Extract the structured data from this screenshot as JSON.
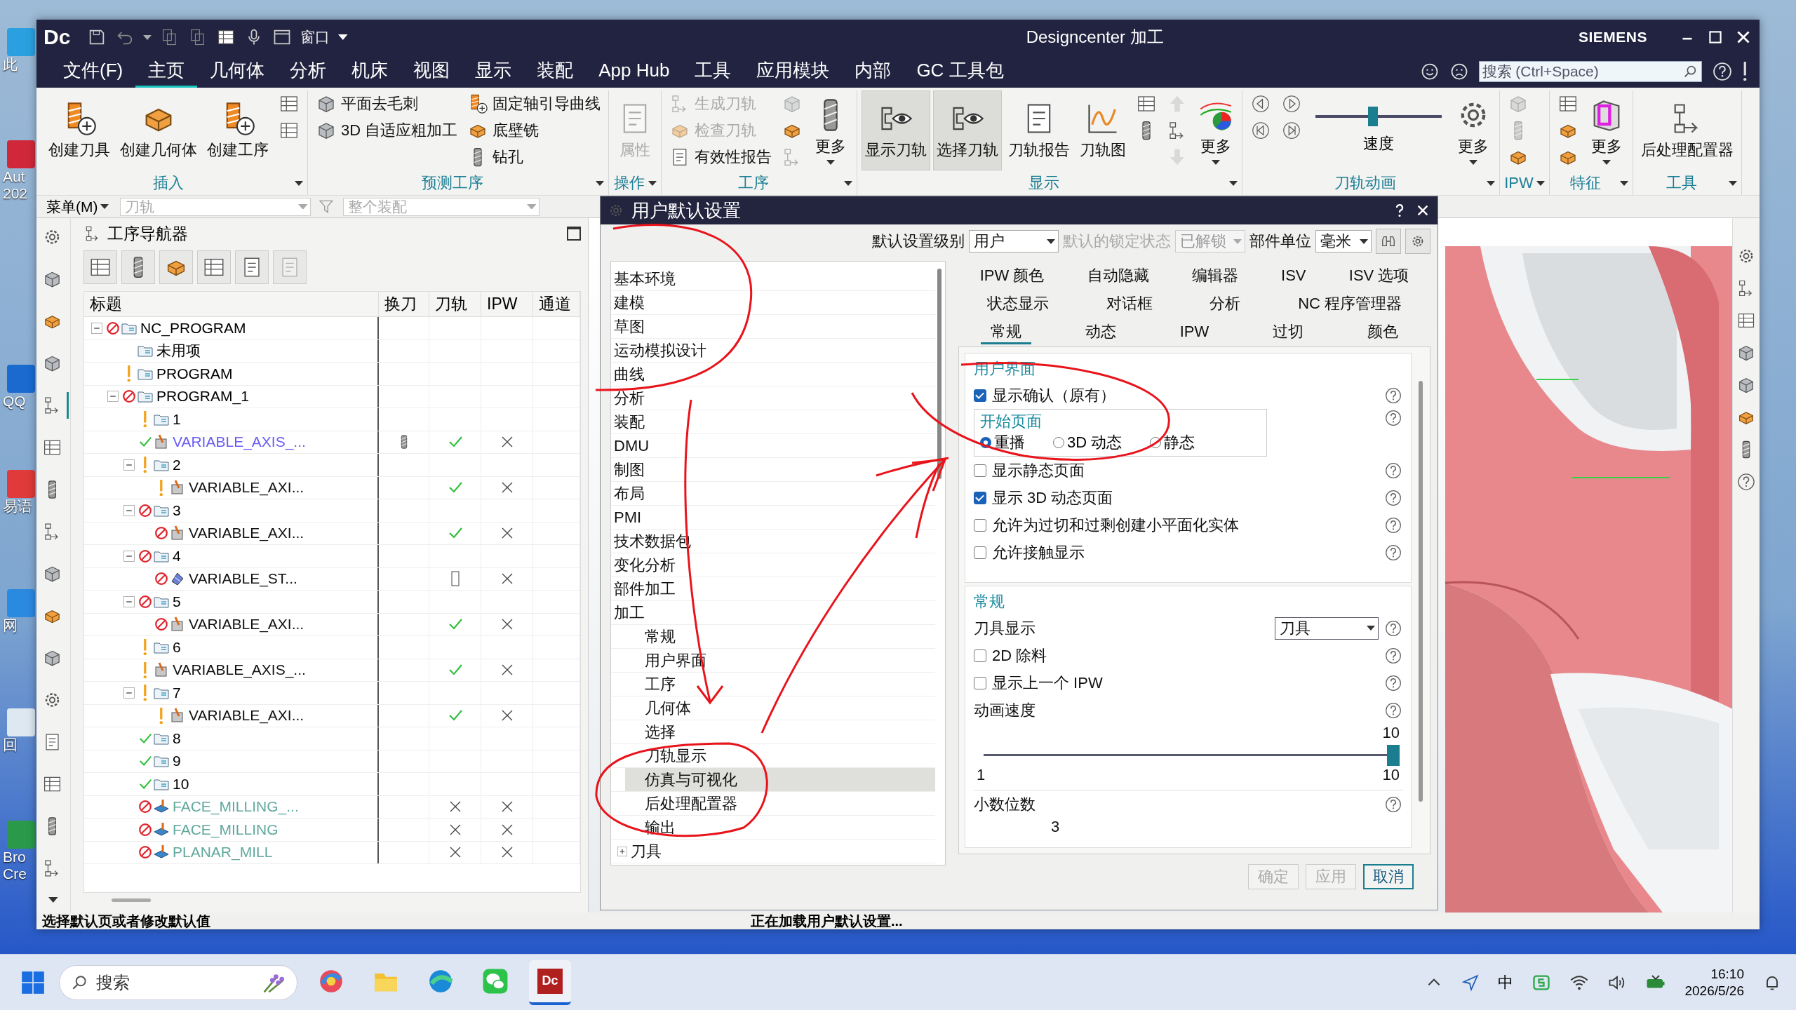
{
  "desktop": {
    "icons": [
      {
        "label": "此"
      },
      {
        "label": "Aut 202"
      },
      {
        "label": "QQ"
      },
      {
        "label": "易语"
      },
      {
        "label": "网"
      },
      {
        "label": "回"
      },
      {
        "label": "Bro Cre"
      }
    ]
  },
  "window": {
    "logo": "Dc",
    "window_menu": "窗口",
    "title": "Designcenter 加工",
    "brand": "SIEMENS"
  },
  "menu_bar": {
    "tabs": [
      {
        "label": "文件(F)",
        "selected": false
      },
      {
        "label": "主页",
        "selected": true
      },
      {
        "label": "几何体",
        "selected": false
      },
      {
        "label": "分析",
        "selected": false
      },
      {
        "label": "机床",
        "selected": false
      },
      {
        "label": "视图",
        "selected": false
      },
      {
        "label": "显示",
        "selected": false
      },
      {
        "label": "装配",
        "selected": false
      },
      {
        "label": "App Hub",
        "selected": false
      },
      {
        "label": "工具",
        "selected": false
      },
      {
        "label": "应用模块",
        "selected": false
      },
      {
        "label": "内部",
        "selected": false
      },
      {
        "label": "GC 工具包",
        "selected": false
      }
    ],
    "search": {
      "placeholder": "搜索 (Ctrl+Space)"
    }
  },
  "ribbon": {
    "groups": [
      {
        "label": "插入",
        "items": [
          {
            "kind": "large",
            "label": "创建刀具",
            "disabled": false,
            "pressed": false
          },
          {
            "kind": "large",
            "label": "创建几何体",
            "disabled": false,
            "pressed": false
          },
          {
            "kind": "large",
            "label": "创建工序",
            "disabled": false,
            "pressed": false
          },
          {
            "kind": "icon",
            "disabled": false,
            "pressed": false
          },
          {
            "kind": "icon",
            "disabled": false,
            "pressed": false
          }
        ]
      },
      {
        "label": "预测工序",
        "items": [
          {
            "kind": "small",
            "label": "平面去毛刺",
            "disabled": false,
            "pressed": false
          },
          {
            "kind": "small",
            "label": "3D 自适应粗加工",
            "disabled": false,
            "pressed": false
          },
          {
            "kind": "spacer"
          },
          {
            "kind": "small",
            "label": "固定轴引导曲线",
            "disabled": false,
            "pressed": false
          },
          {
            "kind": "small",
            "label": "底壁铣",
            "disabled": false,
            "pressed": false
          },
          {
            "kind": "small",
            "label": "钻孔",
            "disabled": false,
            "pressed": false
          }
        ]
      },
      {
        "label": "操作",
        "items": [
          {
            "kind": "large",
            "label": "属性",
            "disabled": true,
            "pressed": false
          }
        ]
      },
      {
        "label": "工序",
        "items": [
          {
            "kind": "small",
            "label": "生成刀轨",
            "disabled": true,
            "pressed": false
          },
          {
            "kind": "small",
            "label": "检查刀轨",
            "disabled": true,
            "pressed": false
          },
          {
            "kind": "small",
            "label": "有效性报告",
            "disabled": false,
            "pressed": false
          },
          {
            "kind": "icon",
            "disabled": true,
            "pressed": false
          },
          {
            "kind": "icon",
            "disabled": false,
            "pressed": false
          },
          {
            "kind": "icon",
            "disabled": true,
            "pressed": false
          },
          {
            "kind": "large",
            "label": "更多",
            "disabled": false,
            "pressed": false
          }
        ]
      },
      {
        "label": "显示",
        "items": [
          {
            "kind": "large",
            "label": "显示刀轨",
            "disabled": false,
            "pressed": true
          },
          {
            "kind": "large",
            "label": "选择刀轨",
            "disabled": false,
            "pressed": true
          },
          {
            "kind": "large",
            "label": "刀轨报告",
            "disabled": false,
            "pressed": false
          },
          {
            "kind": "large",
            "label": "刀轨图",
            "disabled": false,
            "pressed": false
          },
          {
            "kind": "icon",
            "disabled": false,
            "pressed": false
          },
          {
            "kind": "icon",
            "disabled": false,
            "pressed": false
          },
          {
            "kind": "spacer"
          },
          {
            "kind": "icon",
            "disabled": true,
            "pressed": false
          },
          {
            "kind": "icon",
            "disabled": false,
            "pressed": false
          },
          {
            "kind": "icon",
            "disabled": true,
            "pressed": false
          },
          {
            "kind": "large",
            "label": "更多",
            "disabled": false,
            "pressed": false
          }
        ]
      },
      {
        "label": "刀轨动画",
        "items": [
          {
            "kind": "icon",
            "disabled": false,
            "pressed": false
          },
          {
            "kind": "icon",
            "disabled": false,
            "pressed": false
          },
          {
            "kind": "spacer"
          },
          {
            "kind": "icon",
            "disabled": false,
            "pressed": false
          },
          {
            "kind": "icon",
            "disabled": false,
            "pressed": false
          }
        ],
        "slider": {
          "label": "速度",
          "level": 0.45
        },
        "more": {
          "label": "更多"
        }
      },
      {
        "label": "IPW",
        "items": [
          {
            "kind": "icon",
            "disabled": true,
            "pressed": false
          },
          {
            "kind": "icon",
            "disabled": true,
            "pressed": false
          },
          {
            "kind": "icon",
            "disabled": false,
            "pressed": false
          }
        ]
      },
      {
        "label": "特征",
        "items": [
          {
            "kind": "icon",
            "disabled": false,
            "pressed": false
          },
          {
            "kind": "icon",
            "disabled": false,
            "pressed": false
          },
          {
            "kind": "icon",
            "disabled": false,
            "pressed": false
          },
          {
            "kind": "large",
            "label": "更多",
            "disabled": false,
            "pressed": false
          }
        ]
      },
      {
        "label": "工具",
        "items": [
          {
            "kind": "large",
            "label": "后处理配置器",
            "disabled": false,
            "pressed": false
          }
        ]
      }
    ]
  },
  "toolbar": {
    "menu": "菜单(M)",
    "filter": {
      "value": "刀轨",
      "disabled": true
    },
    "scope": {
      "value": "整个装配",
      "disabled": true
    }
  },
  "resource_bar": {
    "tabs": [
      {
        "selected": false
      },
      {
        "selected": false
      },
      {
        "selected": false
      },
      {
        "selected": false
      },
      {
        "selected": true
      },
      {
        "selected": false
      },
      {
        "selected": false
      },
      {
        "selected": false
      },
      {
        "selected": false
      },
      {
        "selected": false
      },
      {
        "selected": false
      },
      {
        "selected": false
      },
      {
        "selected": false
      },
      {
        "selected": false
      },
      {
        "selected": false
      },
      {
        "selected": false
      }
    ]
  },
  "navigator": {
    "title": "工序导航器",
    "toolbar": [
      {
        "disabled": false
      },
      {
        "disabled": false
      },
      {
        "disabled": false
      },
      {
        "disabled": false
      },
      {
        "disabled": false
      },
      {
        "disabled": true
      }
    ],
    "columns": [
      "标题",
      "换刀",
      "刀轨",
      "IPW",
      "通道"
    ],
    "rows": [
      {
        "name": "NC_PROGRAM",
        "kind": "folder",
        "status": {
          "kind": "blocked"
        },
        "expanded": true,
        "children": [
          {
            "name": "未用项",
            "kind": "folder"
          },
          {
            "name": "PROGRAM",
            "kind": "folder",
            "status": {
              "kind": "warning"
            }
          },
          {
            "name": "PROGRAM_1",
            "kind": "folder",
            "status": {
              "kind": "blocked"
            },
            "expanded": true,
            "children": [
              {
                "name": "1",
                "kind": "folder",
                "status": {
                  "kind": "warning"
                }
              },
              {
                "name": "VARIABLE_AXIS_...",
                "kind": "op",
                "status": {
                  "kind": "ok"
                },
                "color": "#6a5cf5",
                "tool_change": {
                  "kind": "tool"
                },
                "toolpath": {
                  "kind": "check"
                },
                "ipw": {
                  "kind": "cross"
                }
              },
              {
                "name": "2",
                "kind": "folder",
                "status": {
                  "kind": "warning"
                },
                "expanded": true,
                "children": [
                  {
                    "name": "VARIABLE_AXI...",
                    "kind": "op",
                    "status": {
                      "kind": "warning"
                    },
                    "color": "#111111",
                    "toolpath": {
                      "kind": "check"
                    },
                    "ipw": {
                      "kind": "cross"
                    }
                  }
                ]
              },
              {
                "name": "3",
                "kind": "folder",
                "status": {
                  "kind": "blocked"
                },
                "expanded": true,
                "children": [
                  {
                    "name": "VARIABLE_AXI...",
                    "kind": "op",
                    "status": {
                      "kind": "blocked"
                    },
                    "color": "#111111",
                    "toolpath": {
                      "kind": "check"
                    },
                    "ipw": {
                      "kind": "cross"
                    }
                  }
                ]
              },
              {
                "name": "4",
                "kind": "folder",
                "status": {
                  "kind": "blocked"
                },
                "expanded": true,
                "children": [
                  {
                    "name": "VARIABLE_ST...",
                    "kind": "streamline",
                    "status": {
                      "kind": "blocked"
                    },
                    "color": "#111111",
                    "toolpath": {
                      "kind": "box"
                    },
                    "ipw": {
                      "kind": "cross"
                    }
                  }
                ]
              },
              {
                "name": "5",
                "kind": "folder",
                "status": {
                  "kind": "blocked"
                },
                "expanded": true,
                "children": [
                  {
                    "name": "VARIABLE_AXI...",
                    "kind": "op",
                    "status": {
                      "kind": "blocked"
                    },
                    "color": "#111111",
                    "toolpath": {
                      "kind": "check"
                    },
                    "ipw": {
                      "kind": "cross"
                    }
                  }
                ]
              },
              {
                "name": "6",
                "kind": "folder",
                "status": {
                  "kind": "warning"
                }
              },
              {
                "name": "VARIABLE_AXIS_...",
                "kind": "op",
                "status": {
                  "kind": "warning"
                },
                "color": "#111111",
                "toolpath": {
                  "kind": "check"
                },
                "ipw": {
                  "kind": "cross"
                }
              },
              {
                "name": "7",
                "kind": "folder",
                "status": {
                  "kind": "warning"
                },
                "expanded": true,
                "children": [
                  {
                    "name": "VARIABLE_AXI...",
                    "kind": "op",
                    "status": {
                      "kind": "warning"
                    },
                    "color": "#111111",
                    "toolpath": {
                      "kind": "check"
                    },
                    "ipw": {
                      "kind": "cross"
                    }
                  }
                ]
              },
              {
                "name": "8",
                "kind": "folder",
                "status": {
                  "kind": "ok"
                }
              },
              {
                "name": "9",
                "kind": "folder",
                "status": {
                  "kind": "ok"
                }
              },
              {
                "name": "10",
                "kind": "folder",
                "status": {
                  "kind": "ok"
                }
              },
              {
                "name": "FACE_MILLING_...",
                "kind": "face",
                "status": {
                  "kind": "blocked"
                },
                "color": "#5fa89c",
                "toolpath": {
                  "kind": "cross"
                },
                "ipw": {
                  "kind": "cross"
                }
              },
              {
                "name": "FACE_MILLING",
                "kind": "face",
                "status": {
                  "kind": "blocked"
                },
                "color": "#5fa89c",
                "toolpath": {
                  "kind": "cross"
                },
                "ipw": {
                  "kind": "cross"
                }
              },
              {
                "name": "PLANAR_MILL",
                "kind": "face",
                "status": {
                  "kind": "blocked"
                },
                "color": "#5fa89c",
                "toolpath": {
                  "kind": "cross"
                },
                "ipw": {
                  "kind": "cross"
                }
              }
            ]
          }
        ]
      }
    ]
  },
  "dialog": {
    "title": "用户默认设置",
    "level_label": "默认设置级别",
    "level": {
      "value": "用户"
    },
    "lock_label": "默认的锁定状态",
    "lock": {
      "value": "已解锁",
      "disabled": true
    },
    "units_label": "部件单位",
    "units": {
      "value": "毫米"
    },
    "tree": [
      {
        "label": "基本环境",
        "selected": false
      },
      {
        "label": "建模",
        "selected": false
      },
      {
        "label": "草图",
        "selected": false
      },
      {
        "label": "运动模拟设计",
        "selected": false
      },
      {
        "label": "曲线",
        "selected": false
      },
      {
        "label": "分析",
        "selected": false
      },
      {
        "label": "装配",
        "selected": false
      },
      {
        "label": "DMU",
        "selected": false
      },
      {
        "label": "制图",
        "selected": false
      },
      {
        "label": "布局",
        "selected": false
      },
      {
        "label": "PMI",
        "selected": false
      },
      {
        "label": "技术数据包",
        "selected": false
      },
      {
        "label": "变化分析",
        "selected": false
      },
      {
        "label": "部件加工",
        "selected": false
      },
      {
        "label": "加工",
        "selected": false,
        "expanded": true,
        "children": [
          {
            "label": "常规",
            "selected": false
          },
          {
            "label": "用户界面",
            "selected": false
          },
          {
            "label": "工序",
            "selected": false
          },
          {
            "label": "几何体",
            "selected": false
          },
          {
            "label": "选择",
            "selected": false
          },
          {
            "label": "刀轨显示",
            "selected": false
          },
          {
            "label": "仿真与可视化",
            "selected": true
          },
          {
            "label": "后处理配置器",
            "selected": false
          },
          {
            "label": "输出",
            "selected": false
          }
        ]
      },
      {
        "label": "刀具",
        "selected": false,
        "expanded": false
      }
    ],
    "tab_rows": [
      [
        {
          "label": "IPW 颜色",
          "selected": false
        },
        {
          "label": "自动隐藏",
          "selected": false
        },
        {
          "label": "编辑器",
          "selected": false
        },
        {
          "label": "ISV",
          "selected": false
        },
        {
          "label": "ISV 选项",
          "selected": false
        }
      ],
      [
        {
          "label": "状态显示",
          "selected": false
        },
        {
          "label": "对话框",
          "selected": false
        },
        {
          "label": "分析",
          "selected": false
        },
        {
          "label": "NC 程序管理器",
          "selected": false
        }
      ],
      [
        {
          "label": "常规",
          "selected": true
        },
        {
          "label": "动态",
          "selected": false
        },
        {
          "label": "IPW",
          "selected": false
        },
        {
          "label": "过切",
          "selected": false
        },
        {
          "label": "颜色",
          "selected": false
        }
      ]
    ],
    "sections": [
      {
        "title": "用户界面",
        "rows": [
          {
            "kind": "checkbox",
            "label": "显示确认（原有）",
            "checked": true
          },
          {
            "kind": "radio_group",
            "title": "开始页面",
            "options": [
              {
                "label": "重播",
                "selected": true
              },
              {
                "label": "3D 动态",
                "selected": false
              },
              {
                "label": "静态",
                "selected": false
              }
            ]
          },
          {
            "kind": "checkbox",
            "label": "显示静态页面",
            "checked": false
          },
          {
            "kind": "checkbox",
            "label": "显示 3D 动态页面",
            "checked": true
          },
          {
            "kind": "checkbox",
            "label": "允许为过切和过剩创建小平面化实体",
            "checked": false
          },
          {
            "kind": "checkbox",
            "label": "允许接触显示",
            "checked": false
          }
        ]
      },
      {
        "title": "常规",
        "rows": [
          {
            "kind": "dropdown",
            "label": "刀具显示",
            "value": "刀具"
          },
          {
            "kind": "checkbox",
            "label": "2D 除料",
            "checked": false
          },
          {
            "kind": "checkbox",
            "label": "显示上一个 IPW",
            "checked": false
          },
          {
            "kind": "slider",
            "label": "动画速度",
            "reading": "10",
            "min": "1",
            "max": "10",
            "level": 1.0
          },
          {
            "kind": "number",
            "label": "小数位数",
            "value": "3"
          }
        ]
      }
    ],
    "buttons": [
      {
        "label": "确定",
        "disabled": true
      },
      {
        "label": "应用",
        "disabled": true
      },
      {
        "label": "取消",
        "disabled": false
      }
    ]
  },
  "status_bar": {
    "prompt": "选择默认页或者修改默认值",
    "message": "正在加载用户默认设置..."
  },
  "taskbar": {
    "search": {
      "placeholder": "搜索"
    },
    "apps": [
      {
        "selected": false
      },
      {
        "selected": false
      },
      {
        "selected": false
      },
      {
        "selected": false
      },
      {
        "label": "Dc",
        "selected": true
      }
    ],
    "ime": "中",
    "time": "16:10",
    "date": "2026/5/26"
  }
}
